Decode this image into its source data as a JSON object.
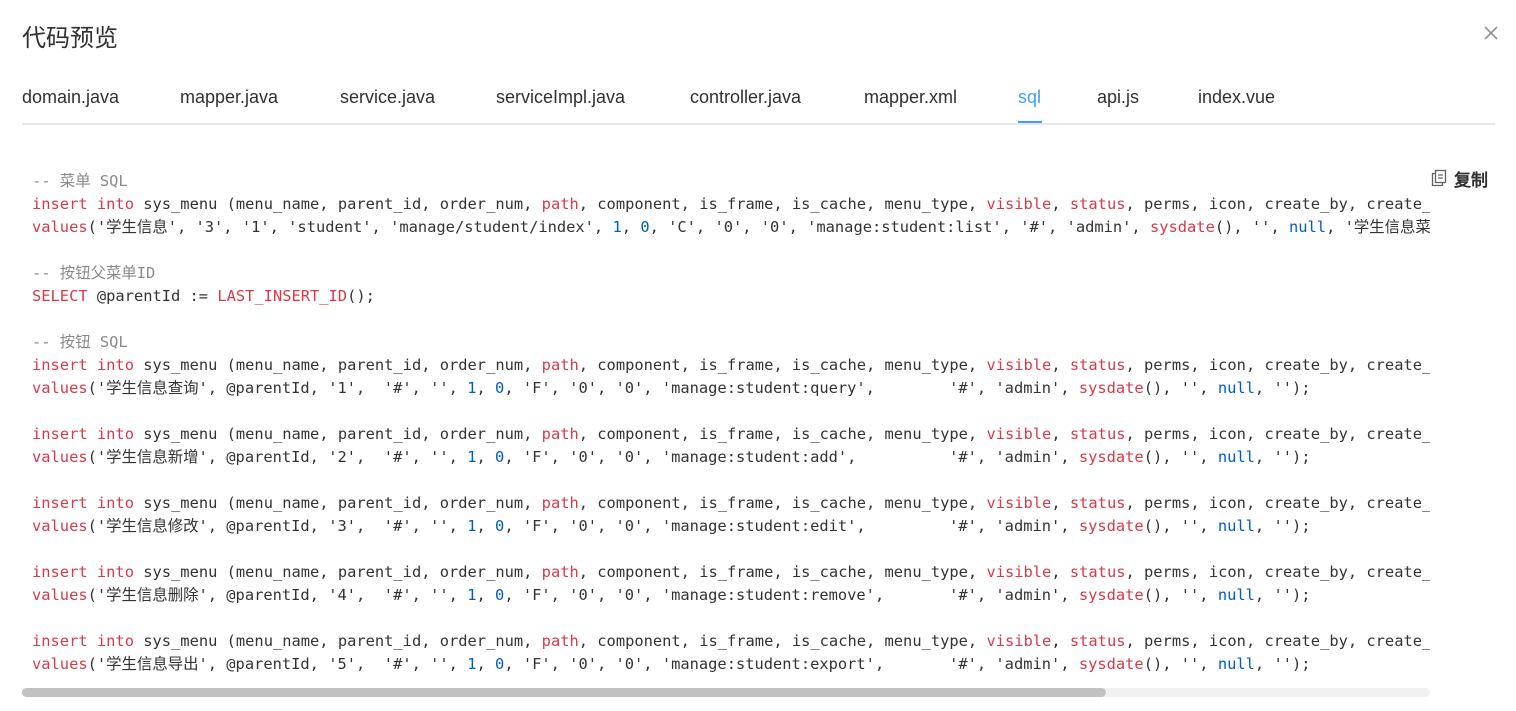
{
  "dialog": {
    "title": "代码预览"
  },
  "tabs": [
    {
      "label": "domain.java",
      "active": false
    },
    {
      "label": "mapper.java",
      "active": false
    },
    {
      "label": "service.java",
      "active": false
    },
    {
      "label": "serviceImpl.java",
      "active": false
    },
    {
      "label": "controller.java",
      "active": false
    },
    {
      "label": "mapper.xml",
      "active": false
    },
    {
      "label": "sql",
      "active": true
    },
    {
      "label": "api.js",
      "active": false
    },
    {
      "label": "index.vue",
      "active": false
    }
  ],
  "copy_button": {
    "label": "复制",
    "icon": "copy-icon"
  },
  "code_lines": [
    [
      [
        "cm",
        "-- 菜单 SQL"
      ]
    ],
    [
      [
        "kw",
        "insert"
      ],
      [
        "",
        " "
      ],
      [
        "kw",
        "into"
      ],
      [
        "",
        " sys_menu (menu_name, parent_id, order_num, "
      ],
      [
        "kw",
        "path"
      ],
      [
        "",
        ", component, is_frame, is_cache, menu_type, "
      ],
      [
        "kw",
        "visible"
      ],
      [
        "",
        ", "
      ],
      [
        "kw",
        "status"
      ],
      [
        "",
        ", perms, icon, create_by, create_time, update_by, update_time, remark)"
      ]
    ],
    [
      [
        "kw",
        "values"
      ],
      [
        "",
        "('学生信息', '3', '1', 'student', 'manage/student/index', "
      ],
      [
        "num",
        "1"
      ],
      [
        "",
        ", "
      ],
      [
        "num",
        "0"
      ],
      [
        "",
        ", 'C', '0', '0', 'manage:student:list', '#', 'admin', "
      ],
      [
        "kw",
        "sysdate"
      ],
      [
        "",
        "(), '', "
      ],
      [
        "num",
        "null"
      ],
      [
        "",
        ", '学生信息菜单');"
      ]
    ],
    [],
    [
      [
        "cm",
        "-- 按钮父菜单ID"
      ]
    ],
    [
      [
        "kw",
        "SELECT"
      ],
      [
        "",
        " @parentId := "
      ],
      [
        "kw",
        "LAST_INSERT_ID"
      ],
      [
        "",
        "();"
      ]
    ],
    [],
    [
      [
        "cm",
        "-- 按钮 SQL"
      ]
    ],
    [
      [
        "kw",
        "insert"
      ],
      [
        "",
        " "
      ],
      [
        "kw",
        "into"
      ],
      [
        "",
        " sys_menu (menu_name, parent_id, order_num, "
      ],
      [
        "kw",
        "path"
      ],
      [
        "",
        ", component, is_frame, is_cache, menu_type, "
      ],
      [
        "kw",
        "visible"
      ],
      [
        "",
        ", "
      ],
      [
        "kw",
        "status"
      ],
      [
        "",
        ", perms, icon, create_by, create_time, update_by, update_time, remark)"
      ]
    ],
    [
      [
        "kw",
        "values"
      ],
      [
        "",
        "('学生信息查询', @parentId, '1',  '#', '', "
      ],
      [
        "num",
        "1"
      ],
      [
        "",
        ", "
      ],
      [
        "num",
        "0"
      ],
      [
        "",
        ", 'F', '0', '0', 'manage:student:query',        '#', 'admin', "
      ],
      [
        "kw",
        "sysdate"
      ],
      [
        "",
        "(), '', "
      ],
      [
        "num",
        "null"
      ],
      [
        "",
        ", '');"
      ]
    ],
    [],
    [
      [
        "kw",
        "insert"
      ],
      [
        "",
        " "
      ],
      [
        "kw",
        "into"
      ],
      [
        "",
        " sys_menu (menu_name, parent_id, order_num, "
      ],
      [
        "kw",
        "path"
      ],
      [
        "",
        ", component, is_frame, is_cache, menu_type, "
      ],
      [
        "kw",
        "visible"
      ],
      [
        "",
        ", "
      ],
      [
        "kw",
        "status"
      ],
      [
        "",
        ", perms, icon, create_by, create_time, update_by, update_time, remark)"
      ]
    ],
    [
      [
        "kw",
        "values"
      ],
      [
        "",
        "('学生信息新增', @parentId, '2',  '#', '', "
      ],
      [
        "num",
        "1"
      ],
      [
        "",
        ", "
      ],
      [
        "num",
        "0"
      ],
      [
        "",
        ", 'F', '0', '0', 'manage:student:add',          '#', 'admin', "
      ],
      [
        "kw",
        "sysdate"
      ],
      [
        "",
        "(), '', "
      ],
      [
        "num",
        "null"
      ],
      [
        "",
        ", '');"
      ]
    ],
    [],
    [
      [
        "kw",
        "insert"
      ],
      [
        "",
        " "
      ],
      [
        "kw",
        "into"
      ],
      [
        "",
        " sys_menu (menu_name, parent_id, order_num, "
      ],
      [
        "kw",
        "path"
      ],
      [
        "",
        ", component, is_frame, is_cache, menu_type, "
      ],
      [
        "kw",
        "visible"
      ],
      [
        "",
        ", "
      ],
      [
        "kw",
        "status"
      ],
      [
        "",
        ", perms, icon, create_by, create_time, update_by, update_time, remark)"
      ]
    ],
    [
      [
        "kw",
        "values"
      ],
      [
        "",
        "('学生信息修改', @parentId, '3',  '#', '', "
      ],
      [
        "num",
        "1"
      ],
      [
        "",
        ", "
      ],
      [
        "num",
        "0"
      ],
      [
        "",
        ", 'F', '0', '0', 'manage:student:edit',         '#', 'admin', "
      ],
      [
        "kw",
        "sysdate"
      ],
      [
        "",
        "(), '', "
      ],
      [
        "num",
        "null"
      ],
      [
        "",
        ", '');"
      ]
    ],
    [],
    [
      [
        "kw",
        "insert"
      ],
      [
        "",
        " "
      ],
      [
        "kw",
        "into"
      ],
      [
        "",
        " sys_menu (menu_name, parent_id, order_num, "
      ],
      [
        "kw",
        "path"
      ],
      [
        "",
        ", component, is_frame, is_cache, menu_type, "
      ],
      [
        "kw",
        "visible"
      ],
      [
        "",
        ", "
      ],
      [
        "kw",
        "status"
      ],
      [
        "",
        ", perms, icon, create_by, create_time, update_by, update_time, remark)"
      ]
    ],
    [
      [
        "kw",
        "values"
      ],
      [
        "",
        "('学生信息删除', @parentId, '4',  '#', '', "
      ],
      [
        "num",
        "1"
      ],
      [
        "",
        ", "
      ],
      [
        "num",
        "0"
      ],
      [
        "",
        ", 'F', '0', '0', 'manage:student:remove',       '#', 'admin', "
      ],
      [
        "kw",
        "sysdate"
      ],
      [
        "",
        "(), '', "
      ],
      [
        "num",
        "null"
      ],
      [
        "",
        ", '');"
      ]
    ],
    [],
    [
      [
        "kw",
        "insert"
      ],
      [
        "",
        " "
      ],
      [
        "kw",
        "into"
      ],
      [
        "",
        " sys_menu (menu_name, parent_id, order_num, "
      ],
      [
        "kw",
        "path"
      ],
      [
        "",
        ", component, is_frame, is_cache, menu_type, "
      ],
      [
        "kw",
        "visible"
      ],
      [
        "",
        ", "
      ],
      [
        "kw",
        "status"
      ],
      [
        "",
        ", perms, icon, create_by, create_time, update_by, update_time, remark)"
      ]
    ],
    [
      [
        "kw",
        "values"
      ],
      [
        "",
        "('学生信息导出', @parentId, '5',  '#', '', "
      ],
      [
        "num",
        "1"
      ],
      [
        "",
        ", "
      ],
      [
        "num",
        "0"
      ],
      [
        "",
        ", 'F', '0', '0', 'manage:student:export',       '#', 'admin', "
      ],
      [
        "kw",
        "sysdate"
      ],
      [
        "",
        "(), '', "
      ],
      [
        "num",
        "null"
      ],
      [
        "",
        ", '');"
      ]
    ]
  ],
  "colors": {
    "accent": "#409eff",
    "keyword": "#d73a49",
    "number": "#005cc5",
    "comment": "#8a8a8a",
    "text": "#303133"
  },
  "horizontal_scroll_fraction": 0.77
}
